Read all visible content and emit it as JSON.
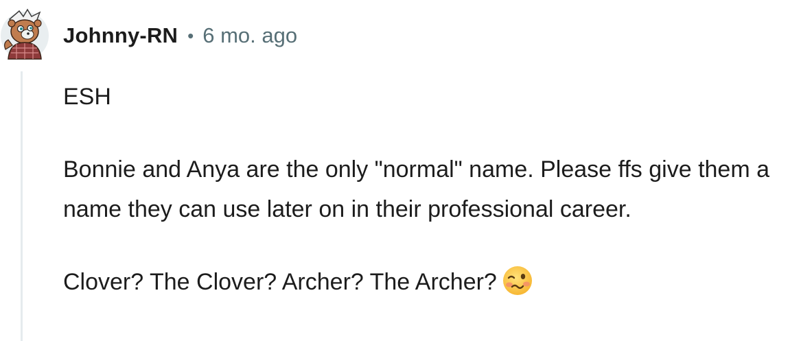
{
  "comment": {
    "author": "Johnny-RN",
    "separator": "•",
    "timestamp": "6 mo. ago",
    "paragraphs": {
      "p1": "ESH",
      "p2": "Bonnie and Anya are the only \"normal\" name. Please ffs give them a name they can use later on in their professional career.",
      "p3": "Clover? The Clover? Archer? The Archer?"
    },
    "emoji": "woozy-face",
    "colors": {
      "text": "#1c1c1c",
      "meta": "#576f76",
      "thread_line": "#e5ebee"
    }
  }
}
